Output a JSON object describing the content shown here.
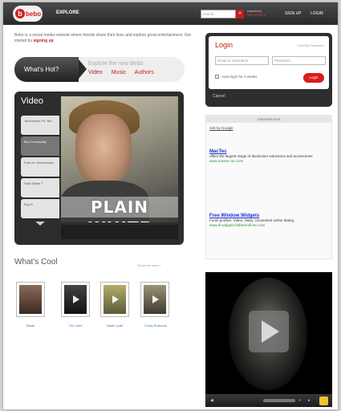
{
  "topbar": {
    "logo_text": "bebo",
    "explore_label": "EXPLORE",
    "search_placeholder": "search",
    "search_button": "»",
    "powered_line1": "powered by",
    "powered_brand": "MSN SEARCH",
    "signup_label": "SIGN UP",
    "login_label": "LOGIN"
  },
  "intro": {
    "text": "Bebo is a social media network where friends share their lives and explore great entertainment.  Get started by",
    "link": "signing up"
  },
  "whats_hot": {
    "label": "What's Hot?",
    "title": "Explore the new Bebo",
    "links": [
      "Video",
      "Music",
      "Authors"
    ]
  },
  "video": {
    "title": "Video",
    "tabs": [
      "Jamestown Po: Bro",
      "Bro Community",
      "Fold on: Anniversary",
      "Plain White T",
      "Boy N"
    ],
    "active_tab_index": 1,
    "overlay_text": "PLAIN WHITE"
  },
  "whats_cool": {
    "title": "What's Cool",
    "link": "Show me more ›",
    "items": [
      {
        "label": "Sarah"
      },
      {
        "label": "The Lees"
      },
      {
        "label": "Adam Lyall"
      },
      {
        "label": "Crazy Rumours"
      }
    ]
  },
  "login": {
    "title": "Login",
    "forgot": "I lost My Password",
    "email_placeholder": "Email or Username",
    "password_placeholder": "Password",
    "remember_label": "Auto-login for 2 weeks",
    "button_label": "Login",
    "cancel_label": "Cancel"
  },
  "ad": {
    "header": "Advertisement",
    "google": "Ads by Google",
    "items": [
      {
        "title": "MacTec",
        "body": "offers the largest range of aluminium extrusions and accessories",
        "url": "www.mactec-inc.com"
      },
      {
        "title": "Free Window Widgets",
        "body": "Fresh profiles. Video, Stats, convenient online dating.",
        "url": "www.ifi-widgets-hdfeed-sft-inc.com"
      }
    ]
  },
  "player": {
    "play_label": "▶",
    "rew_label": "◀",
    "fwd_label": "▸",
    "vol_label": "+"
  },
  "colors": {
    "brand_red": "#d91c1c",
    "topbar": "#2a2a2a",
    "link_blue": "#3b6fb6"
  }
}
